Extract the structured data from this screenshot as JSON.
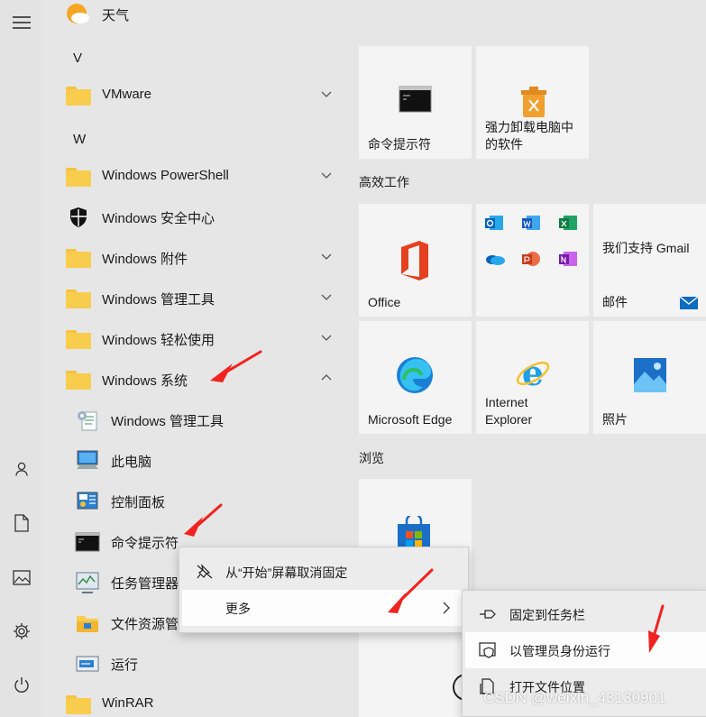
{
  "app_list": {
    "weather_label": "天气",
    "letter_v": "V",
    "vmware": "VMware",
    "letter_w": "W",
    "powershell": "Windows PowerShell",
    "security": "Windows 安全中心",
    "accessories": "Windows 附件",
    "admin_tools": "Windows 管理工具",
    "ease_of_access": "Windows 轻松使用",
    "system": "Windows 系统",
    "sub_admin_tools": "Windows 管理工具",
    "this_pc": "此电脑",
    "control_panel": "控制面板",
    "cmd": "命令提示符",
    "task_manager": "任务管理器",
    "explorer": "文件资源管理器",
    "run": "运行",
    "winrar": "WinRAR"
  },
  "tiles": {
    "cmd": "命令提示符",
    "uninstall_line1": "强力卸载电脑中",
    "uninstall_line2": "的软件",
    "group_productivity": "高效工作",
    "office": "Office",
    "mail_top": "我们支持 Gmail",
    "mail_label": "邮件",
    "edge": "Microsoft Edge",
    "ie_line1": "Internet",
    "ie_line2": "Explorer",
    "photos": "照片",
    "group_browse": "浏览"
  },
  "context_menu": {
    "unpin": "从“开始”屏幕取消固定",
    "more": "更多"
  },
  "submenu": {
    "pin_taskbar": "固定到任务栏",
    "run_as_admin": "以管理员身份运行",
    "open_location": "打开文件位置"
  },
  "watermark": "CSDN @weixin_43130901",
  "colors": {
    "annotation_arrow": "#f0231e",
    "folder": "#f8cd4e",
    "office_red": "#e3411f",
    "edge_blue": "#1a80d6"
  }
}
